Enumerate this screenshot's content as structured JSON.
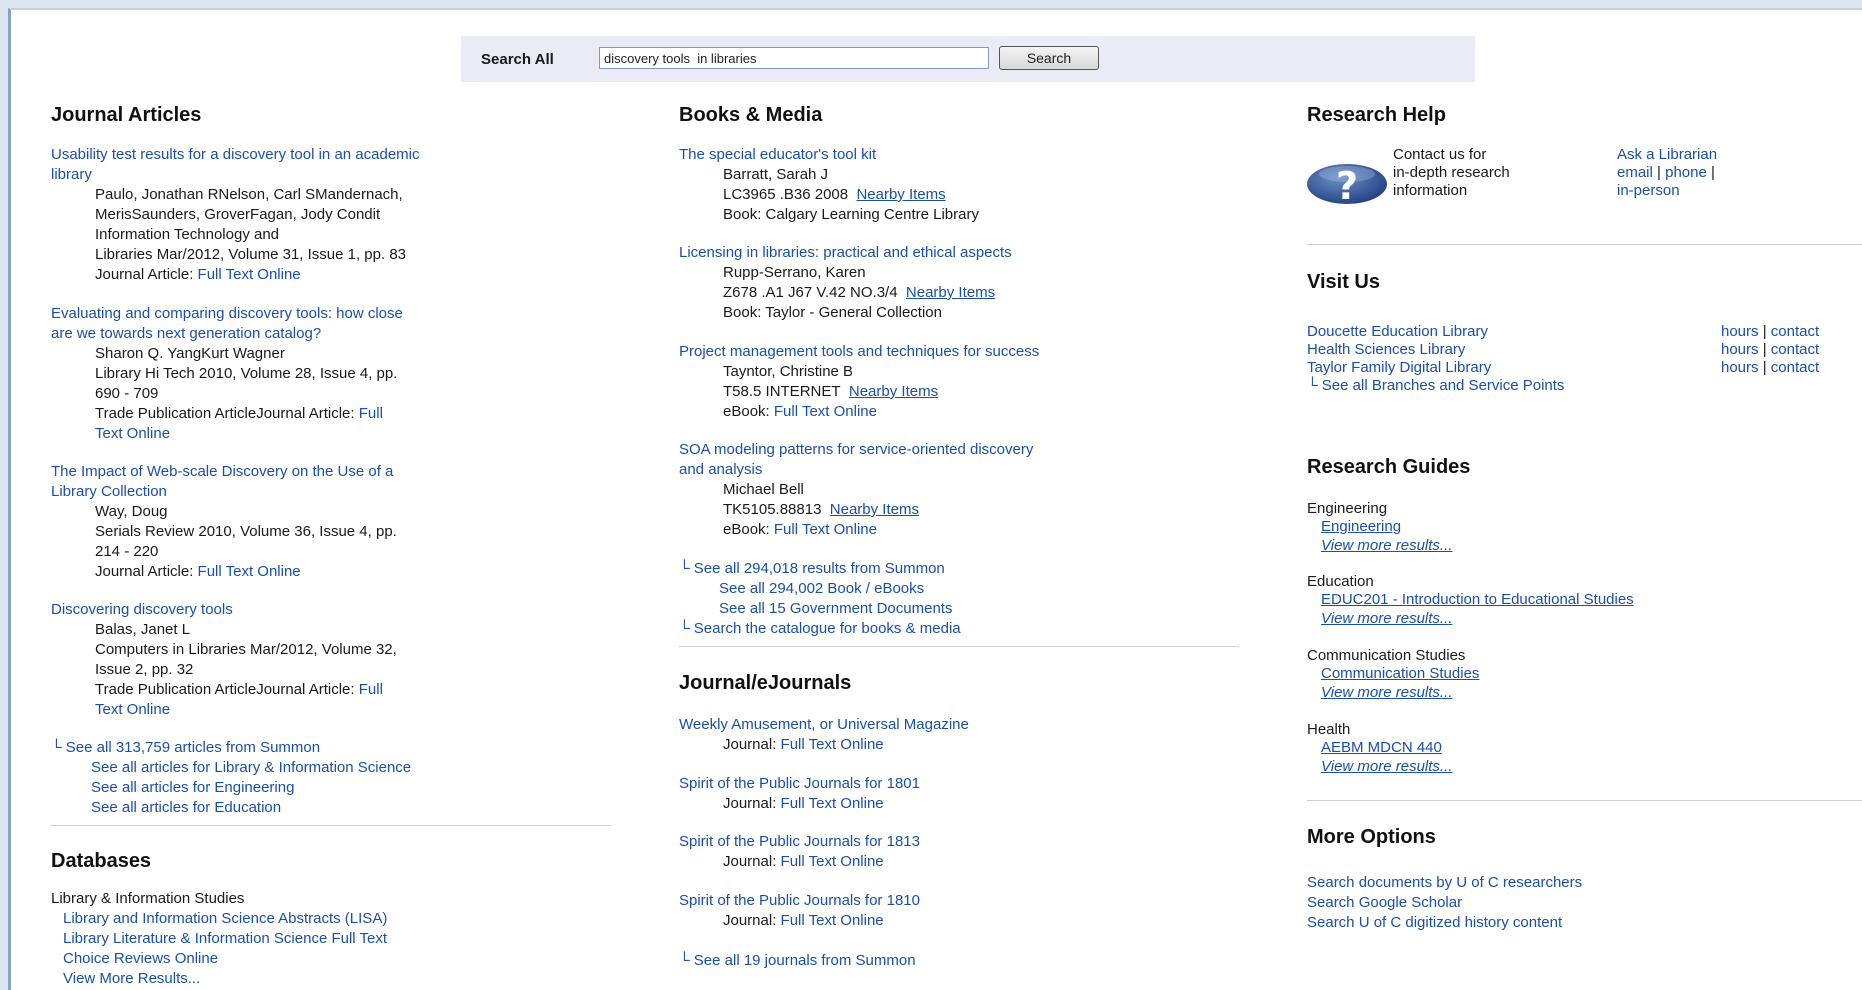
{
  "search": {
    "label": "Search All",
    "value": "discovery tools  in libraries",
    "button": "Search"
  },
  "journal_articles": {
    "heading": "Journal Articles",
    "items": [
      {
        "title_lines": [
          "Usability test results for a discovery tool in an academic",
          "library"
        ],
        "details": [
          "Paulo, Jonathan RNelson, Carl SMandernach,",
          "MerisSaunders, GroverFagan, Jody Condit",
          "Information Technology and",
          "Libraries Mar/2012, Volume 31, Issue 1, pp. 83"
        ],
        "type_prefix": "Journal Article: ",
        "type_link": "Full Text Online"
      },
      {
        "title_lines": [
          "Evaluating and comparing discovery tools: how close",
          "are we towards next generation catalog?"
        ],
        "details": [
          "Sharon Q. YangKurt Wagner",
          "Library Hi Tech 2010, Volume 28, Issue 4, pp.",
          "690 - 709"
        ],
        "type_prefix": "Trade Publication ArticleJournal Article: ",
        "type_link": "Full",
        "type_link2": "Text Online"
      },
      {
        "title_lines": [
          "The Impact of Web-scale Discovery on the Use of a",
          "Library Collection"
        ],
        "details": [
          "Way, Doug",
          "Serials Review 2010, Volume 36, Issue 4, pp.",
          "214 - 220"
        ],
        "type_prefix": "Journal Article: ",
        "type_link": "Full Text Online"
      },
      {
        "title_lines": [
          "Discovering discovery tools"
        ],
        "details": [
          "Balas, Janet L",
          "Computers in Libraries Mar/2012, Volume 32,",
          "Issue 2, pp. 32"
        ],
        "type_prefix": "Trade Publication ArticleJournal Article: ",
        "type_link": "Full",
        "type_link2": "Text Online"
      }
    ],
    "see_all": "└ See all 313,759 articles from Summon",
    "see_more": [
      "See all articles for Library & Information Science",
      "See all articles for Engineering",
      "See all articles for Education"
    ]
  },
  "databases": {
    "heading": "Databases",
    "category": "Library & Information Studies",
    "links": [
      "Library and Information Science Abstracts (LISA)",
      "Library Literature & Information Science Full Text",
      "Choice Reviews Online",
      "View More Results..."
    ]
  },
  "books_media": {
    "heading": "Books & Media",
    "items": [
      {
        "title_lines": [
          "The special educator's tool kit"
        ],
        "author": "Barratt, Sarah J",
        "callno": "LC3965 .B36 2008",
        "nearby": "Nearby Items",
        "location": "Book: Calgary Learning Centre Library"
      },
      {
        "title_lines": [
          "Licensing in libraries: practical and ethical aspects"
        ],
        "author": "Rupp-Serrano, Karen",
        "callno": "Z678 .A1 J67 V.42 NO.3/4",
        "nearby": "Nearby Items",
        "location": "Book: Taylor - General Collection"
      },
      {
        "title_lines": [
          "Project management tools and techniques for success"
        ],
        "author": "Tayntor, Christine B",
        "callno": "T58.5 INTERNET",
        "nearby": "Nearby Items",
        "location_prefix": "eBook: ",
        "location_link": "Full Text Online"
      },
      {
        "title_lines": [
          "SOA modeling patterns for service-oriented discovery",
          "and analysis"
        ],
        "author": "Michael Bell",
        "callno": "TK5105.88813",
        "nearby": "Nearby Items",
        "location_prefix": "eBook: ",
        "location_link": "Full Text Online"
      }
    ],
    "see_all": "└ See all 294,018 results from Summon",
    "see_more": [
      "See all 294,002 Book / eBooks",
      "See all 15 Government Documents"
    ],
    "catalogue": "└ Search the catalogue for books & media"
  },
  "journals": {
    "heading": "Journal/eJournals",
    "items": [
      {
        "title": "Weekly Amusement, or Universal Magazine",
        "prefix": "Journal: ",
        "link": "Full Text Online"
      },
      {
        "title": "Spirit of the Public Journals for 1801",
        "prefix": "Journal: ",
        "link": "Full Text Online"
      },
      {
        "title": "Spirit of the Public Journals for 1813",
        "prefix": "Journal: ",
        "link": "Full Text Online"
      },
      {
        "title": "Spirit of the Public Journals for 1810",
        "prefix": "Journal: ",
        "link": "Full Text Online"
      }
    ],
    "see_all": "└ See all 19 journals from Summon"
  },
  "research_help": {
    "heading": "Research Help",
    "contact": [
      "Contact us for",
      "in-depth research",
      "information"
    ],
    "ask": "Ask a Librarian",
    "email": "email",
    "phone": "phone",
    "sep": "|",
    "inperson": "in-person"
  },
  "visit_us": {
    "heading": "Visit Us",
    "branches": [
      {
        "name": "Doucette Education Library",
        "hours": "hours",
        "contact": "contact"
      },
      {
        "name": "Health Sciences Library",
        "hours": "hours",
        "contact": "contact"
      },
      {
        "name": "Taylor Family Digital Library",
        "hours": "hours",
        "contact": "contact"
      }
    ],
    "see_all": "└ See all Branches and Service Points"
  },
  "guides": {
    "heading": "Research Guides",
    "groups": [
      {
        "subject": "Engineering",
        "guide": "Engineering",
        "more": "View more results..."
      },
      {
        "subject": "Education",
        "guide": "EDUC201 - Introduction to Educational Studies",
        "more": "View more results..."
      },
      {
        "subject": "Communication Studies",
        "guide": "Communication Studies",
        "more": "View more results..."
      },
      {
        "subject": "Health",
        "guide": "AEBM MDCN 440",
        "more": "View more results..."
      }
    ]
  },
  "more_options": {
    "heading": "More Options",
    "links": [
      "Search documents by U of C researchers",
      "Search Google Scholar",
      "Search U of C digitized history content"
    ]
  }
}
